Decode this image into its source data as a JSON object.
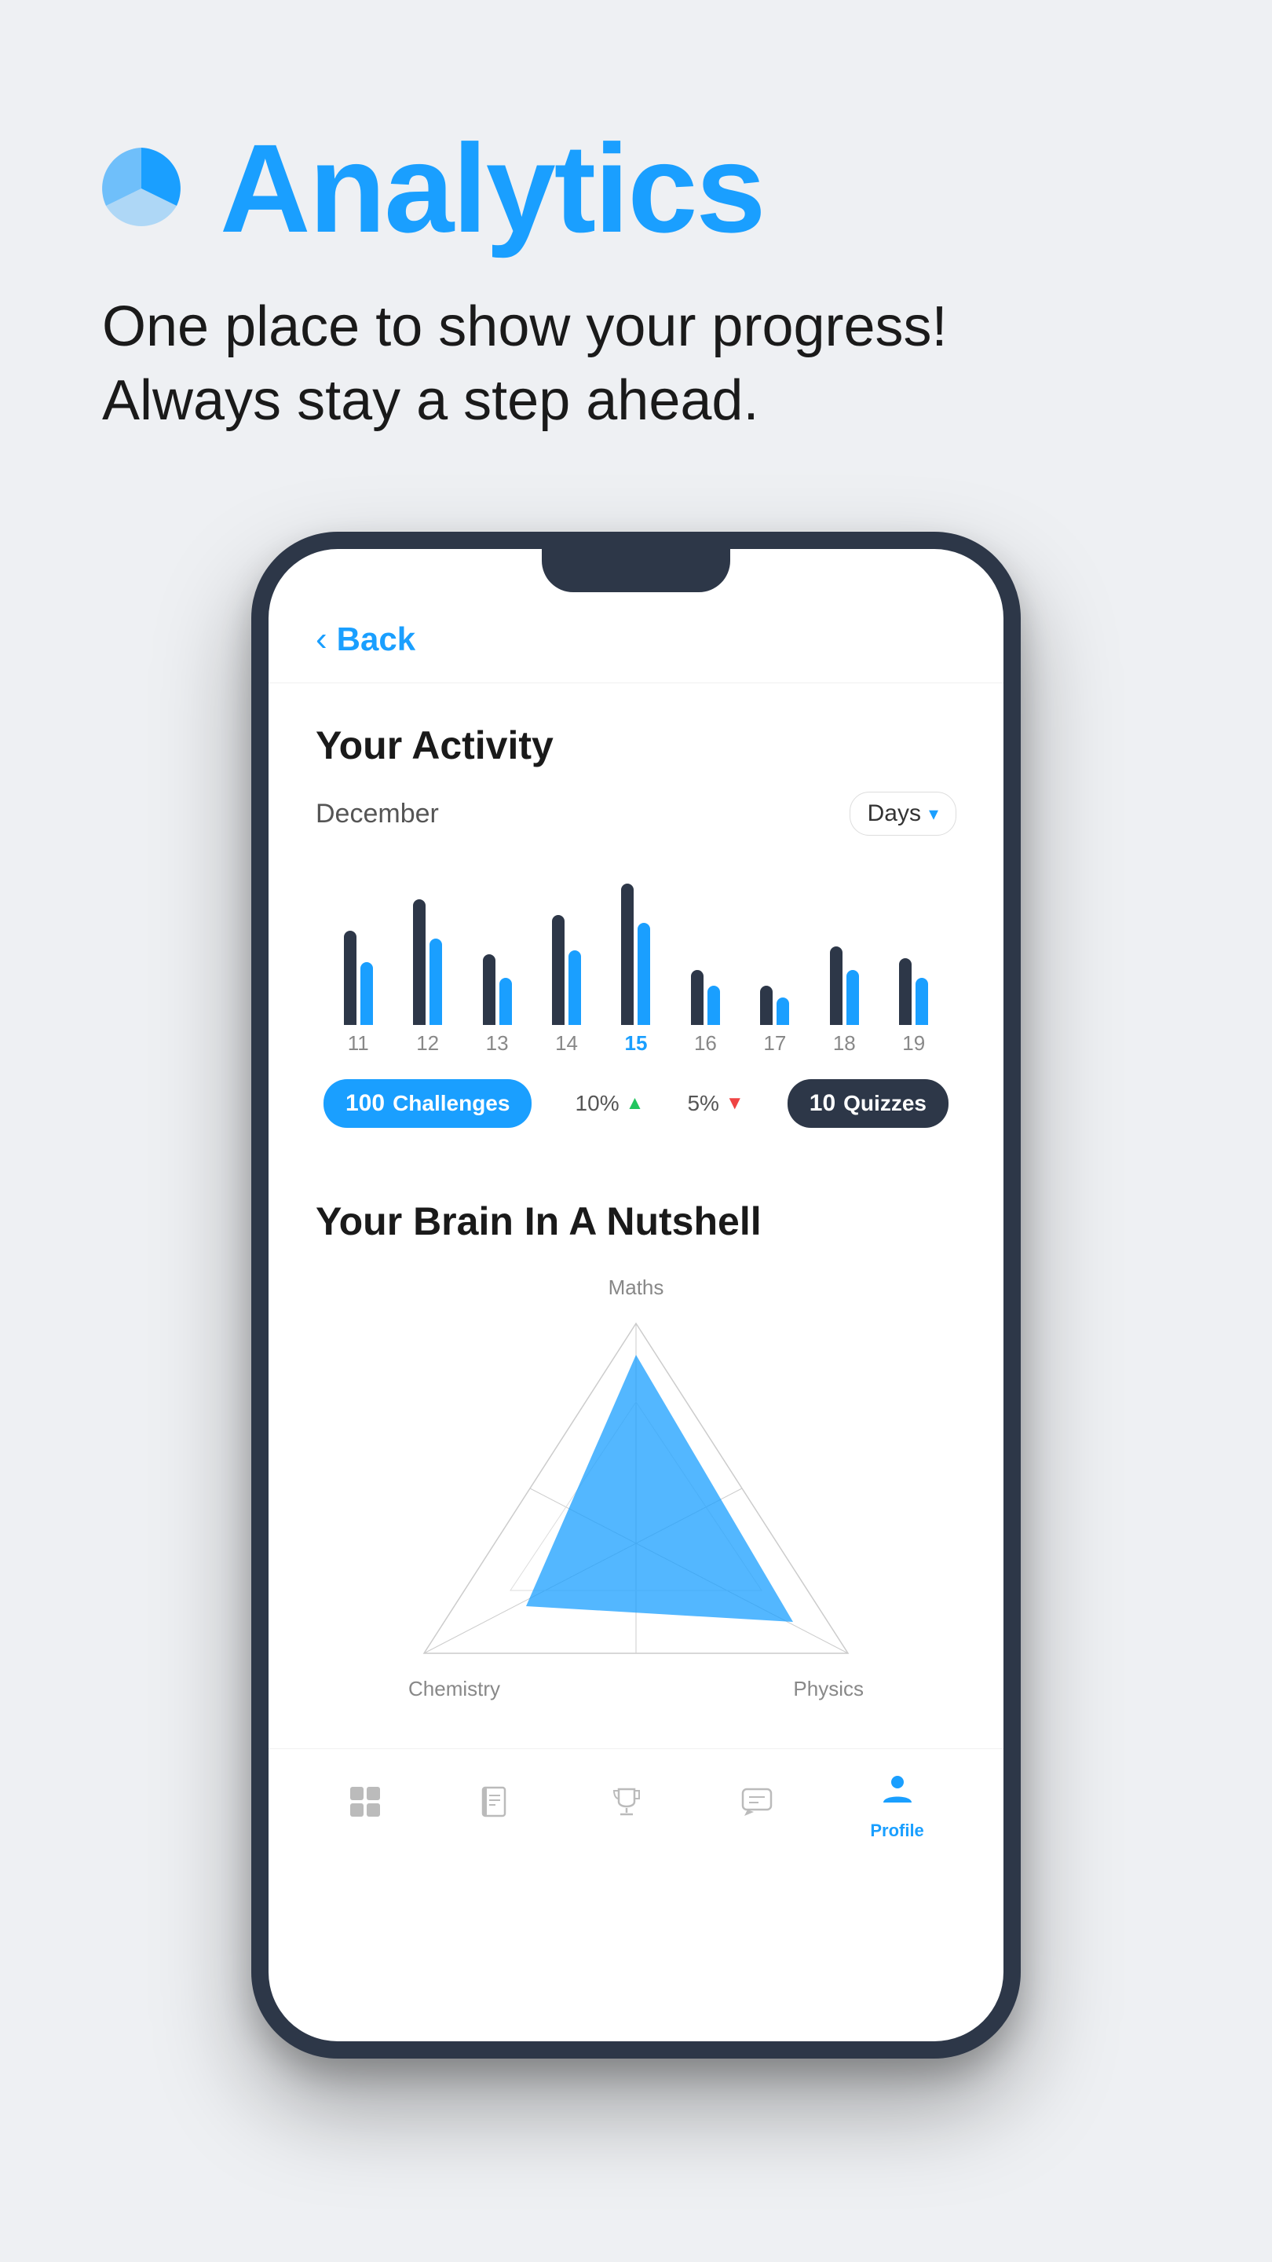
{
  "header": {
    "icon_label": "analytics-pie-icon",
    "title": "Analytics",
    "subtitle_line1": "One place to show your progress!",
    "subtitle_line2": "Always stay a step ahead."
  },
  "phone": {
    "back_button": "Back",
    "activity": {
      "title": "Your Activity",
      "month": "December",
      "filter": "Days",
      "bars": [
        {
          "day": "11",
          "dark_h": 120,
          "blue_h": 80
        },
        {
          "day": "12",
          "dark_h": 160,
          "blue_h": 110
        },
        {
          "day": "13",
          "dark_h": 90,
          "blue_h": 60
        },
        {
          "day": "14",
          "dark_h": 140,
          "blue_h": 95
        },
        {
          "day": "15",
          "dark_h": 180,
          "blue_h": 130,
          "active": true
        },
        {
          "day": "16",
          "dark_h": 70,
          "blue_h": 50
        },
        {
          "day": "17",
          "dark_h": 50,
          "blue_h": 35
        },
        {
          "day": "18",
          "dark_h": 100,
          "blue_h": 70
        },
        {
          "day": "19",
          "dark_h": 85,
          "blue_h": 60
        }
      ],
      "stats": {
        "challenges_count": "100",
        "challenges_label": "Challenges",
        "challenges_pct": "10%",
        "challenges_trend": "up",
        "quizzes_pct": "5%",
        "quizzes_trend": "down",
        "quizzes_count": "10",
        "quizzes_label": "Quizzes"
      }
    },
    "brain": {
      "title": "Your Brain In A Nutshell",
      "label_top": "Maths",
      "label_bottom_left": "Chemistry",
      "label_bottom_right": "Physics"
    },
    "nav": [
      {
        "icon": "⊞",
        "label": "Home",
        "active": false
      },
      {
        "icon": "📖",
        "label": "Study",
        "active": false
      },
      {
        "icon": "🏆",
        "label": "Rank",
        "active": false
      },
      {
        "icon": "💬",
        "label": "Chat",
        "active": false
      },
      {
        "icon": "👤",
        "label": "Profile",
        "active": true
      }
    ]
  }
}
